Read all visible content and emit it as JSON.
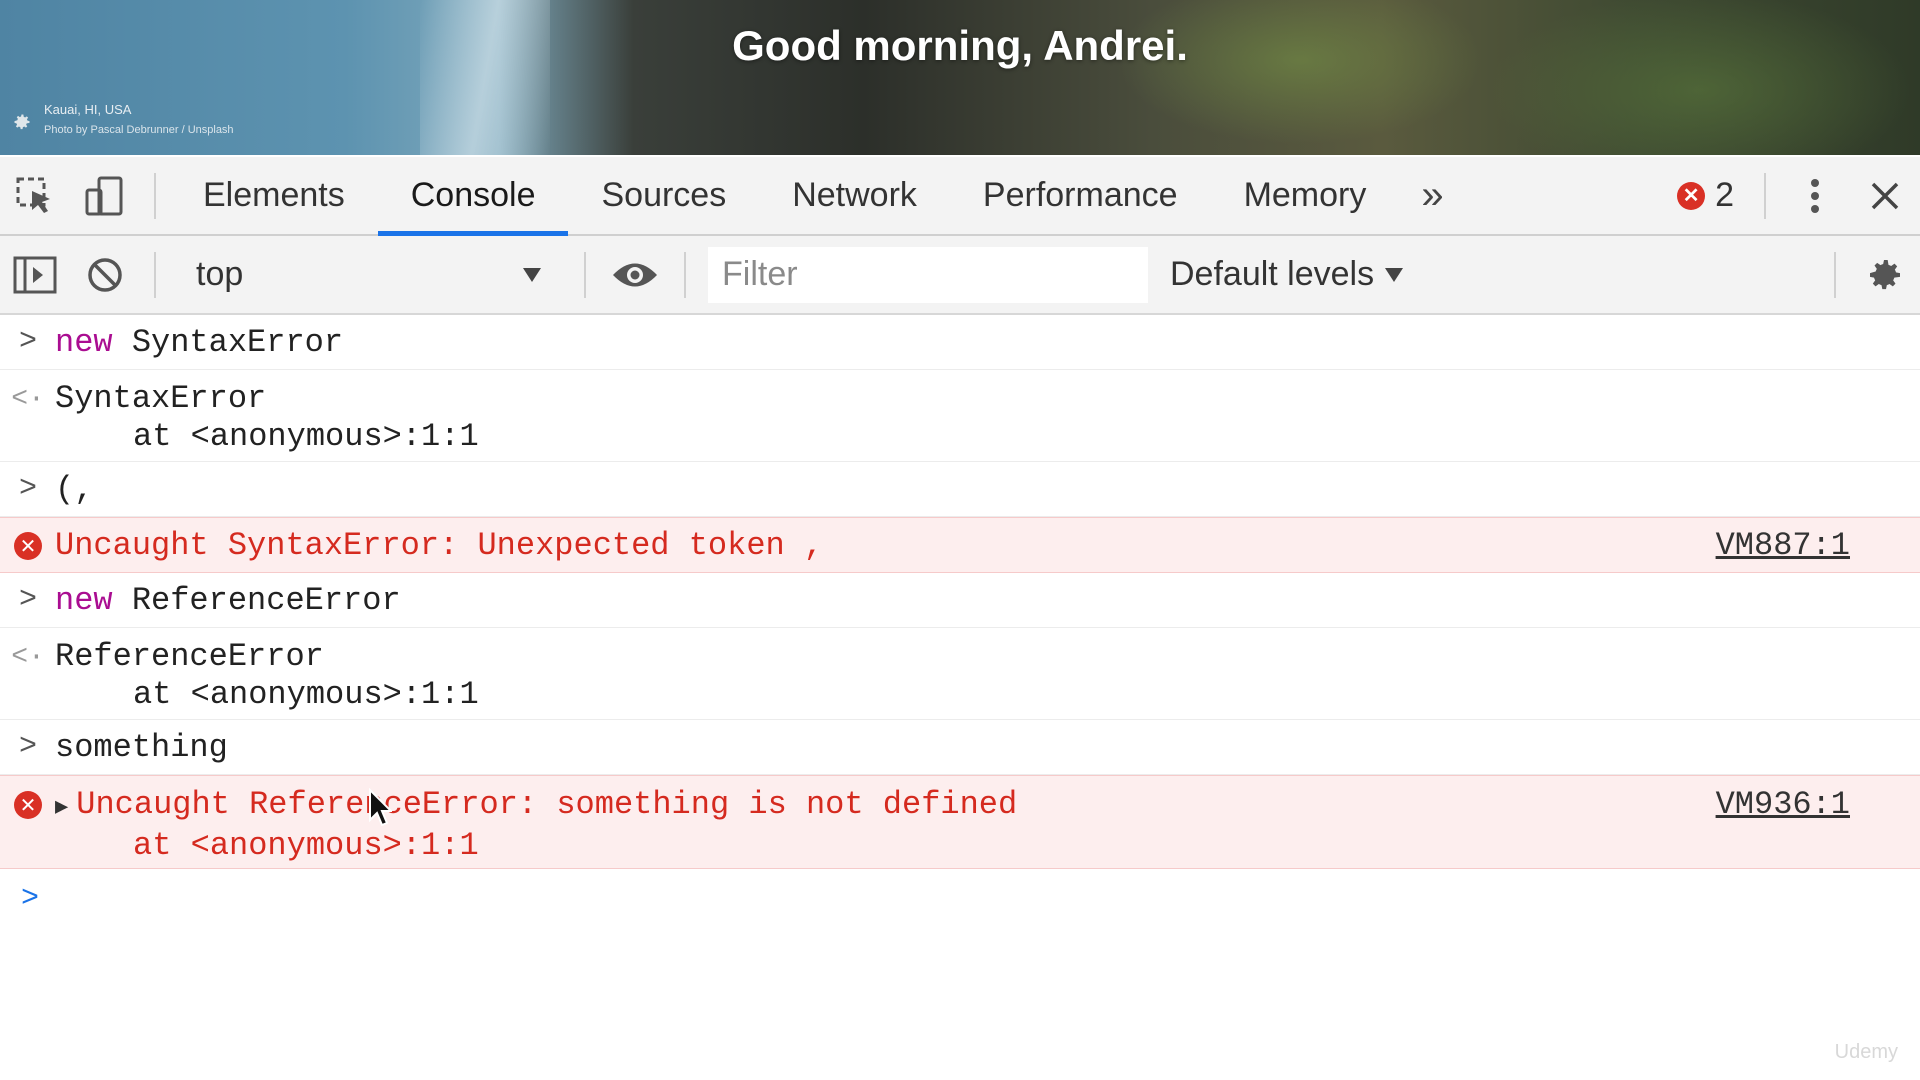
{
  "banner": {
    "greeting": "Good morning, Andrei.",
    "location": "Kauai, HI, USA",
    "photo_credit": "Photo by Pascal Debrunner / Unsplash"
  },
  "devtools": {
    "tabs": [
      {
        "label": "Elements",
        "active": false
      },
      {
        "label": "Console",
        "active": true
      },
      {
        "label": "Sources",
        "active": false
      },
      {
        "label": "Network",
        "active": false
      },
      {
        "label": "Performance",
        "active": false
      },
      {
        "label": "Memory",
        "active": false
      }
    ],
    "more_tabs": "»",
    "error_count": "2"
  },
  "toolbar": {
    "context": "top",
    "filter_placeholder": "Filter",
    "levels": "Default levels"
  },
  "console": {
    "entries": {
      "e1_kw": "new",
      "e1_rest": " SyntaxError",
      "e2_line1": "SyntaxError",
      "e2_line2": "at <anonymous>:1:1",
      "e3": "(,",
      "e4": "Uncaught SyntaxError: Unexpected token ,",
      "e4_src": "VM887:1",
      "e5_kw": "new",
      "e5_rest": " ReferenceError",
      "e6_line1": "ReferenceError",
      "e6_line2": "at <anonymous>:1:1",
      "e7": "something",
      "e8_line1": "Uncaught ReferenceError: something is not defined",
      "e8_line2": "at <anonymous>:1:1",
      "e8_src": "VM936:1"
    }
  },
  "watermark": "Udemy",
  "colors": {
    "accent": "#1a73e8",
    "error_text": "#d52a1f",
    "error_bg": "#fdeeee",
    "keyword": "#aa0d91"
  }
}
